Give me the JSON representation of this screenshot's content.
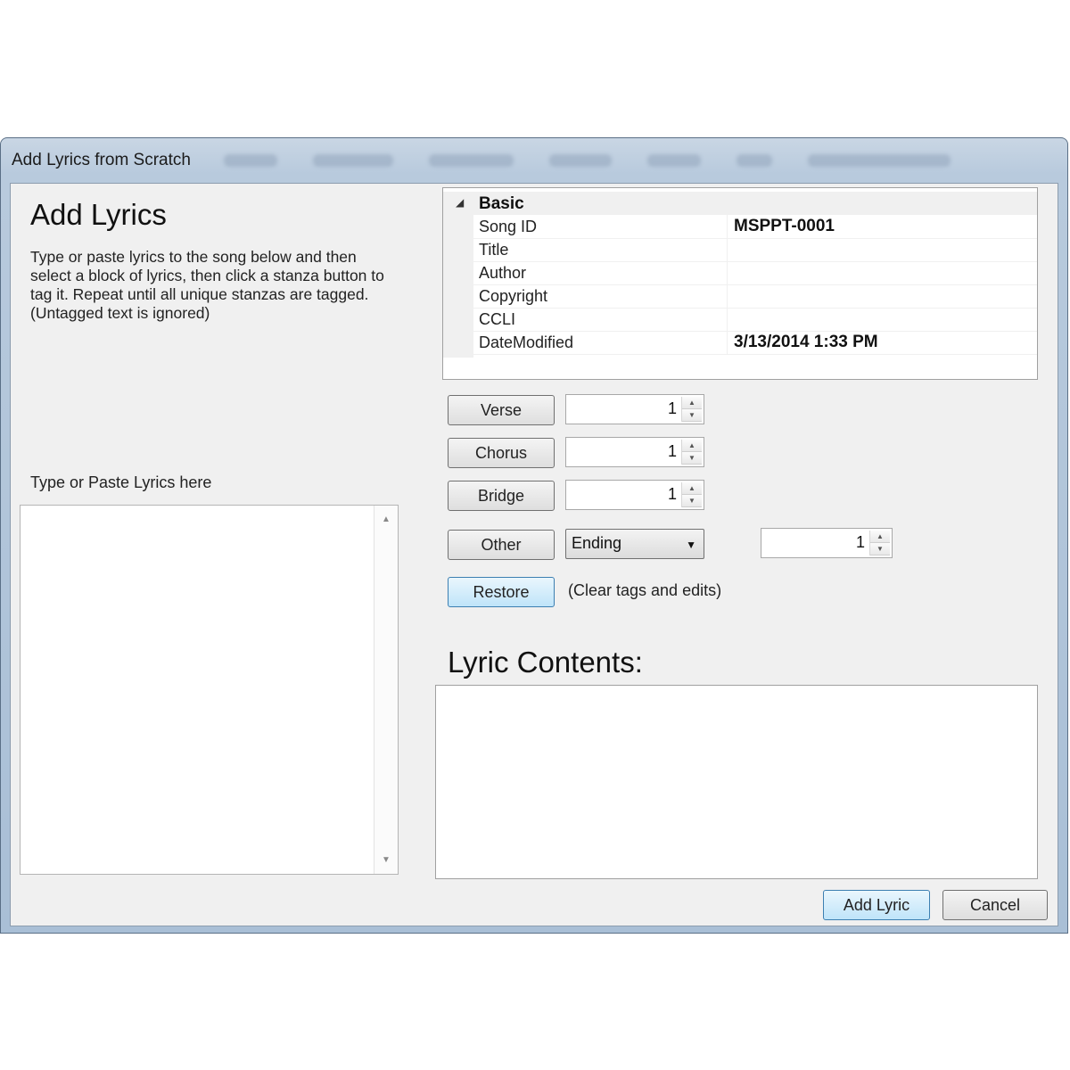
{
  "window": {
    "title": "Add Lyrics from Scratch"
  },
  "left": {
    "heading": "Add Lyrics",
    "description": "Type or paste lyrics to the song below and then select a block of lyrics, then click a stanza button to tag it. Repeat until all unique stanzas are tagged. (Untagged text is ignored)",
    "paste_label": "Type or Paste Lyrics here",
    "lyrics_text": ""
  },
  "properties": {
    "category": "Basic",
    "rows": [
      {
        "key": "Song ID",
        "value": "MSPPT-0001"
      },
      {
        "key": "Title",
        "value": ""
      },
      {
        "key": "Author",
        "value": ""
      },
      {
        "key": "Copyright",
        "value": ""
      },
      {
        "key": "CCLI",
        "value": ""
      },
      {
        "key": "DateModified",
        "value": "3/13/2014 1:33 PM"
      }
    ]
  },
  "stanzas": {
    "verse": {
      "label": "Verse",
      "count": "1"
    },
    "chorus": {
      "label": "Chorus",
      "count": "1"
    },
    "bridge": {
      "label": "Bridge",
      "count": "1"
    },
    "other": {
      "label": "Other",
      "selected": "Ending",
      "count": "1"
    }
  },
  "restore": {
    "label": "Restore",
    "note": "(Clear tags and edits)"
  },
  "lyric_contents": {
    "title": "Lyric Contents:",
    "text": ""
  },
  "footer": {
    "add_label": "Add Lyric",
    "cancel_label": "Cancel"
  }
}
